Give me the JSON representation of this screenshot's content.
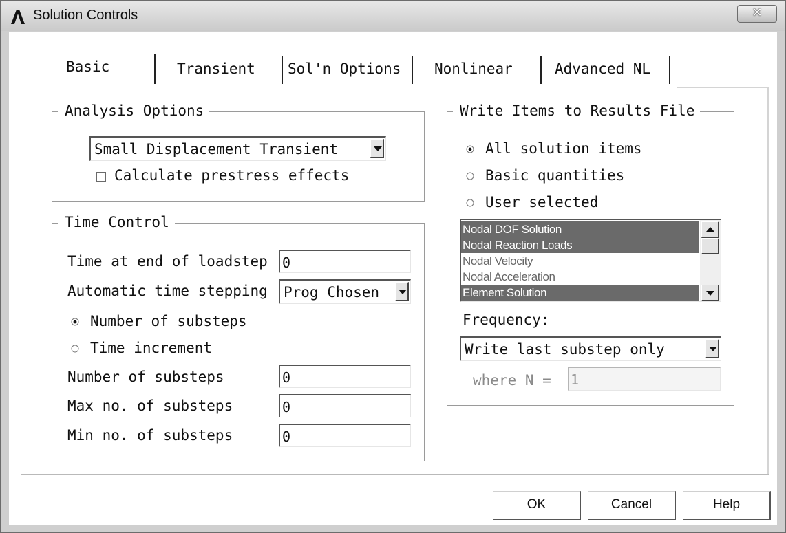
{
  "window": {
    "title": "Solution Controls"
  },
  "tabs": [
    {
      "label": "Basic"
    },
    {
      "label": "Transient"
    },
    {
      "label": "Sol'n Options"
    },
    {
      "label": "Nonlinear"
    },
    {
      "label": "Advanced NL"
    }
  ],
  "analysis_options": {
    "legend": "Analysis Options",
    "analysis_type": "Small Displacement Transient",
    "prestress_label": "Calculate prestress effects",
    "prestress_checked": false
  },
  "time_control": {
    "legend": "Time Control",
    "time_at_end_label": "Time at end of loadstep",
    "time_at_end_value": "0",
    "auto_stepping_label": "Automatic time stepping",
    "auto_stepping_value": "Prog Chosen",
    "radio_substeps_label": "Number of substeps",
    "radio_increment_label": "Time increment",
    "selected_radio": "Number of substeps",
    "num_substeps_label": "Number of substeps",
    "num_substeps_value": "0",
    "max_substeps_label": "Max no. of substeps",
    "max_substeps_value": "0",
    "min_substeps_label": "Min no. of substeps",
    "min_substeps_value": "0"
  },
  "write_items": {
    "legend": "Write Items to Results File",
    "radio_all_label": "All solution items",
    "radio_basic_label": "Basic quantities",
    "radio_user_label": "User selected",
    "selected_radio": "All solution items",
    "list_items": [
      {
        "label": "Nodal DOF Solution",
        "selected": true
      },
      {
        "label": "Nodal Reaction Loads",
        "selected": true
      },
      {
        "label": "Nodal Velocity",
        "selected": false
      },
      {
        "label": "Nodal Acceleration",
        "selected": false
      },
      {
        "label": "Element Solution",
        "selected": true
      }
    ],
    "frequency_label": "Frequency:",
    "frequency_value": "Write last substep only",
    "where_n_label": "where N =",
    "where_n_value": "1"
  },
  "buttons": {
    "ok": "OK",
    "cancel": "Cancel",
    "help": "Help"
  },
  "colors": {
    "selection": "#6a6a6a",
    "window_frame": "#cfcfcf"
  }
}
